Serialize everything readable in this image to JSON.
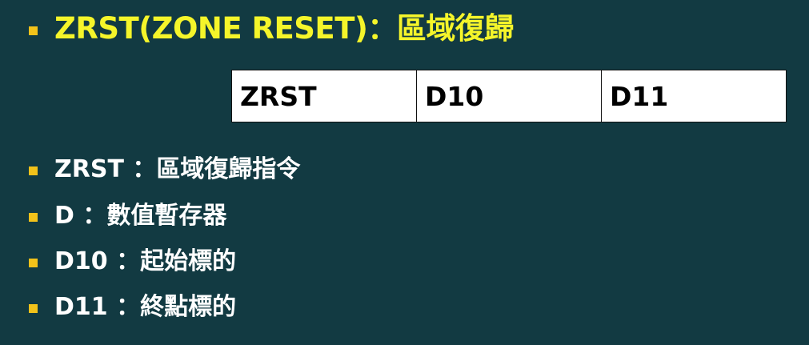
{
  "title": {
    "text": "ZRST(ZONE RESET)：區域復歸"
  },
  "instruction": {
    "cells": [
      "ZRST",
      "D10",
      "D11"
    ]
  },
  "legend": {
    "items": [
      "ZRST ：區域復歸指令",
      "D ：數值暫存器",
      "D10 ：起始標的",
      "D11 ：終點標的"
    ]
  },
  "colors": {
    "background": "#123a42",
    "title": "#f5f52a",
    "bullet": "#f2c21a",
    "text": "#ffffff"
  }
}
